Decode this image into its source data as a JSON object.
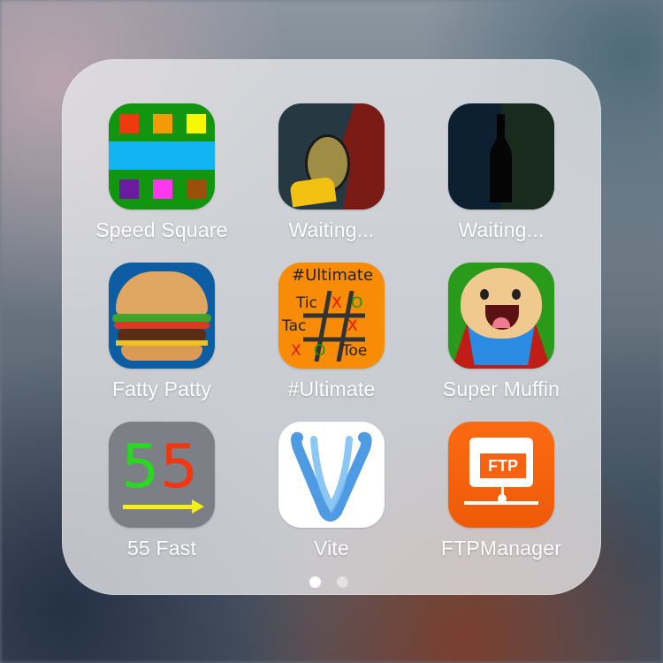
{
  "apps": [
    {
      "label": "Speed Square"
    },
    {
      "label": "Waiting..."
    },
    {
      "label": "Waiting..."
    },
    {
      "label": "Fatty Patty"
    },
    {
      "label": "#Ultimate"
    },
    {
      "label": "Super Muffin"
    },
    {
      "label": "55 Fast"
    },
    {
      "label": "Vite"
    },
    {
      "label": "FTPManager"
    }
  ],
  "ultimate_icon": {
    "line1": "#Ultimate",
    "tic": "Tic",
    "tac": "Tac",
    "toe": "Toe",
    "x1": "X",
    "o1": "O",
    "x2": "X",
    "x3": "X",
    "o2": "O"
  },
  "fast_icon": {
    "digit1": "5",
    "digit2": "5"
  },
  "ftp_icon": {
    "text": "FTP"
  },
  "page_dots": {
    "count": 2,
    "active_index": 0
  },
  "colors": {
    "folder_bg": "#E8E8EB",
    "label_text": "#FFFFFF",
    "speed_green": "#13960F",
    "speed_blue": "#13B4F2",
    "ultimate_orange": "#F98C07",
    "ftp_orange": "#FB6A12",
    "vite_blue": "#2D84D8"
  }
}
